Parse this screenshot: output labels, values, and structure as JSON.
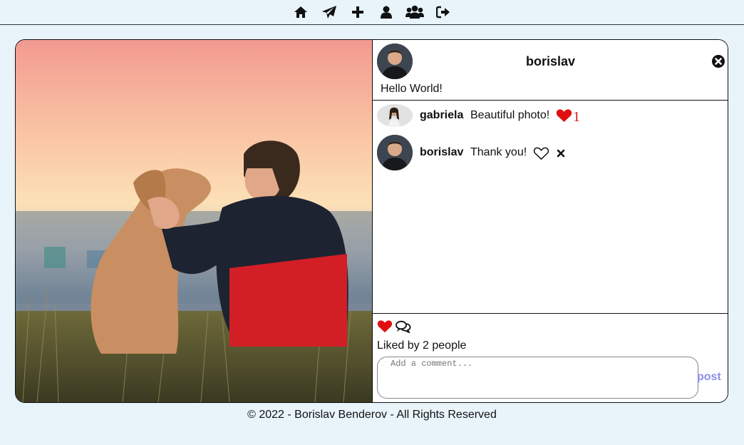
{
  "nav": {
    "icons": [
      "home-icon",
      "send-icon",
      "plus-icon",
      "user-icon",
      "users-icon",
      "sign-out-icon"
    ]
  },
  "post": {
    "owner": "borislav",
    "caption": "Hello World!",
    "likes_text": "Liked by 2 people",
    "liked": true
  },
  "comments": [
    {
      "user": "gabriela",
      "text": "Beautiful photo!",
      "likes": "1",
      "liked": true
    },
    {
      "user": "borislav",
      "text": "Thank you!",
      "likes": "",
      "liked": false
    }
  ],
  "comment_form": {
    "placeholder": "Add a comment...",
    "post_label": "post"
  },
  "footer": {
    "text": "© 2022 - Borislav Benderov - All Rights Reserved"
  },
  "colors": {
    "background": "#e8f4fa",
    "like_red": "#e01010",
    "post_button": "#8a8fe8"
  }
}
